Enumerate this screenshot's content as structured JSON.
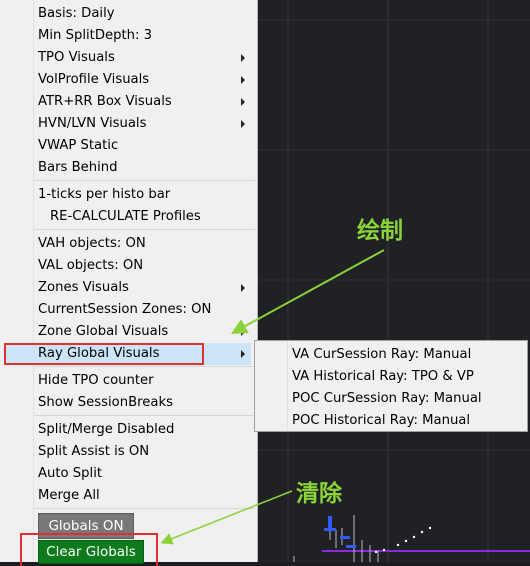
{
  "menu": {
    "items": [
      {
        "label": "Basis: Daily"
      },
      {
        "label": "Min SplitDepth: 3"
      },
      {
        "label": "TPO Visuals",
        "submenu": true
      },
      {
        "label": "VolProfile Visuals",
        "submenu": true
      },
      {
        "label": "ATR+RR Box Visuals",
        "submenu": true
      },
      {
        "label": "HVN/LVN Visuals",
        "submenu": true
      },
      {
        "label": "VWAP Static"
      },
      {
        "label": "Bars Behind"
      },
      {
        "label": "1-ticks per histo bar"
      },
      {
        "label": "RE-CALCULATE Profiles"
      },
      {
        "label": "VAH objects:   ON"
      },
      {
        "label": "VAL objects:   ON"
      },
      {
        "label": "Zones Visuals",
        "submenu": true
      },
      {
        "label": "CurrentSession Zones:  ON"
      },
      {
        "label": "Zone Global Visuals",
        "submenu": true
      },
      {
        "label": "Ray Global Visuals",
        "submenu": true,
        "highlighted": true
      },
      {
        "label": "Hide TPO counter"
      },
      {
        "label": "Show SessionBreaks"
      },
      {
        "label": "Split/Merge Disabled"
      },
      {
        "label": "Split Assist is ON"
      },
      {
        "label": "Auto Split"
      },
      {
        "label": "Merge All"
      }
    ]
  },
  "submenu": {
    "items": [
      {
        "label": "VA CurSession Ray:  Manual"
      },
      {
        "label": "VA Historical Ray:    TPO & VP"
      },
      {
        "label": "POC CurSession Ray:  Manual"
      },
      {
        "label": "POC Historical Ray:   Manual"
      }
    ]
  },
  "buttons": {
    "globals_label": "Globals ON",
    "clear_label": "Clear Globals"
  },
  "annotations": {
    "draw_label": "绘制",
    "clear_label": "清除"
  },
  "colors": {
    "highlight": "#cce4f7",
    "annotation": "#8bd23a",
    "red_box": "#e03030",
    "clear_button": "#0d7a1c",
    "globals_button": "#787878"
  }
}
